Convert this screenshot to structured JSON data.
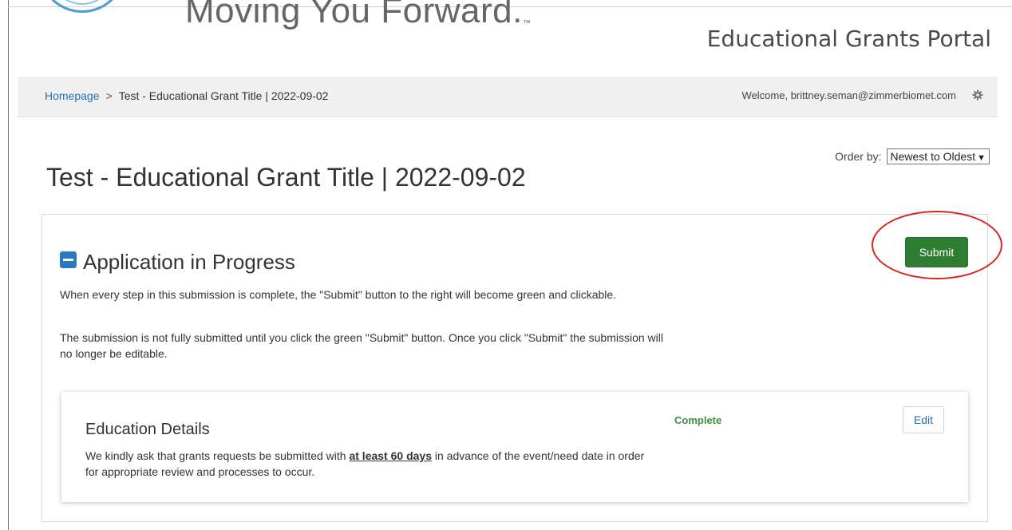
{
  "header": {
    "tagline": "Moving You Forward.",
    "tagline_mark": "™",
    "portal_title": "Educational Grants Portal"
  },
  "breadcrumb": {
    "home_label": "Homepage",
    "separator": ">",
    "current_label": "Test - Educational Grant Title | 2022-09-02"
  },
  "user": {
    "welcome_text": "Welcome, brittney.seman@zimmerbiomet.com",
    "settings_icon": "gear-icon"
  },
  "sort": {
    "label": "Order by:",
    "selected": "Newest to Oldest"
  },
  "page": {
    "title": "Test - Educational Grant Title | 2022-09-02"
  },
  "application": {
    "title": "Application in Progress",
    "collapse_icon": "minus-square-icon",
    "paragraph_1": "When every step in this submission is complete, the \"Submit\" button to the right will become green and clickable.",
    "paragraph_2": "The submission is not fully submitted until you click the green \"Submit\" button. Once you click \"Submit\" the submission will no longer be editable.",
    "submit_label": "Submit",
    "submit_color": "#2e7d32",
    "highlight_color": "#d9241b"
  },
  "steps": [
    {
      "title": "Education Details",
      "status": "Complete",
      "status_color": "#3d8b3f",
      "edit_label": "Edit",
      "desc_before": "We kindly ask that grants requests be submitted with ",
      "desc_emphasis": "at least 60 days",
      "desc_after": " in advance of the event/need date in order for appropriate review and processes to occur."
    }
  ]
}
